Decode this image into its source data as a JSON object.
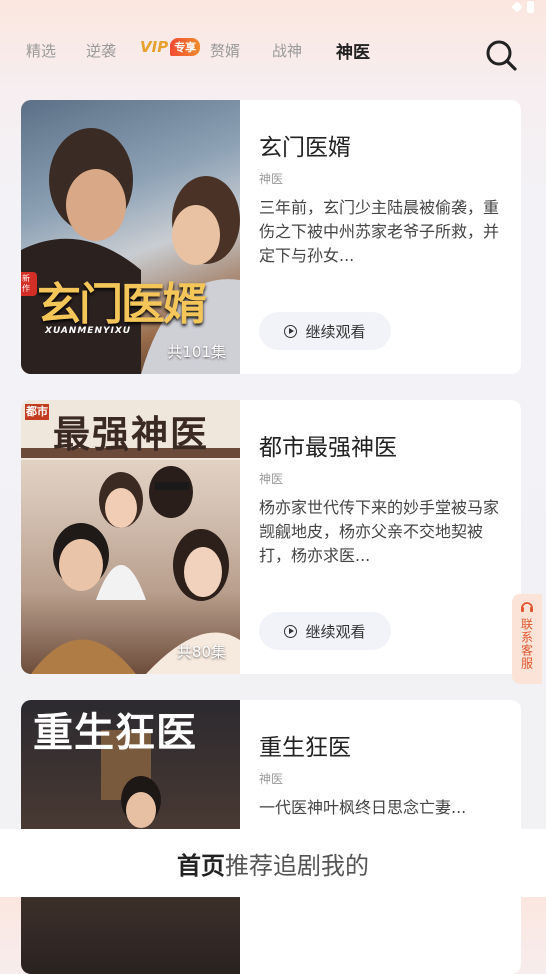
{
  "tabs": [
    {
      "label": "精选"
    },
    {
      "label": "逆袭"
    },
    {
      "label": "赘婿"
    },
    {
      "label": "战神"
    },
    {
      "label": "神医"
    }
  ],
  "vip_tab": {
    "v": "VIP",
    "tag": "专享"
  },
  "dramas": [
    {
      "title": "玄门医婿",
      "genre": "神医",
      "description": "三年前，玄门少主陆晨被偷袭，重伤之下被中州苏家老爷子所救，并定下与孙女...",
      "episodes": "共101集",
      "watch_label": "继续观看",
      "poster_text": "玄门医婿",
      "poster_sub": "XUANMENYIXU",
      "poster_badge": "新作"
    },
    {
      "title": "都市最强神医",
      "genre": "神医",
      "description": "杨亦家世代传下来的妙手堂被马家觊觎地皮，杨亦父亲不交地契被打，杨亦求医...",
      "episodes": "共80集",
      "watch_label": "继续观看",
      "poster_text": "最强神医",
      "poster_prefix": "都市"
    },
    {
      "title": "重生狂医",
      "genre": "神医",
      "description": "一代医神叶枫终日思念亡妻...",
      "episodes": "",
      "watch_label": "",
      "poster_text": "重生狂医"
    }
  ],
  "support": {
    "label": "联系客服"
  },
  "bottom_nav": [
    {
      "label": "首页",
      "active": true
    },
    {
      "label": "推荐"
    },
    {
      "label": "追剧"
    },
    {
      "label": "我的"
    }
  ],
  "colors": {
    "accent": "#e2572f",
    "vip": "#e7a12e",
    "bg": "#f2f2f5"
  }
}
